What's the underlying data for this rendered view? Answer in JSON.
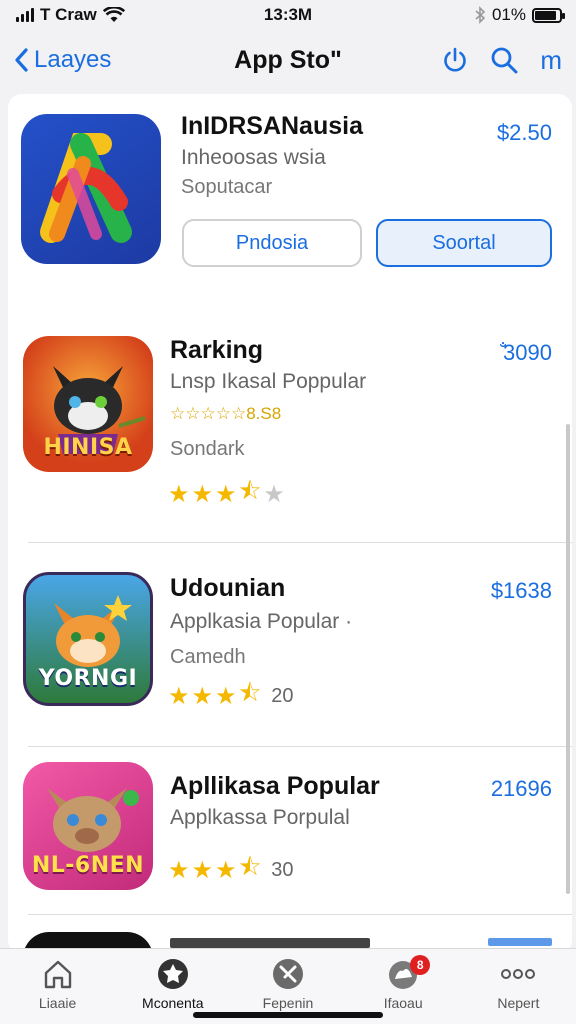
{
  "status_bar": {
    "carrier": "T Craw",
    "time": "13:3M",
    "battery": "01%"
  },
  "nav": {
    "back_label": "Laayes",
    "title": "App Stoʺ",
    "action_m": "m"
  },
  "featured": {
    "name": "InIDRSANausia",
    "subtitle": "Inheoosas wsia",
    "category": "Soputacar",
    "price": "$2.50",
    "button_left": "Pndosia",
    "button_right": "Soortal"
  },
  "apps": [
    {
      "name": "Rarking",
      "subtitle": "Lnsp Ikasal Poppular",
      "mini_rating": "☆☆☆☆☆8.S8",
      "category": "Sondark",
      "price": "̐3090",
      "rating_count": "",
      "icon_text": "HINISA",
      "stars": 3.5
    },
    {
      "name": "Udounian",
      "subtitle": "Applkasia Popular ·",
      "category": "Camedh",
      "price": "$1638",
      "rating_count": "20",
      "icon_text": "YORNGI",
      "stars": 3.5
    },
    {
      "name": "Apllikasa Popular",
      "subtitle": "Applkassa Porpulal",
      "category": "",
      "price": "21696",
      "rating_count": "30",
      "icon_text": "NL-6NEN",
      "stars": 3.5
    }
  ],
  "tabs": [
    {
      "label": "Liaaie",
      "icon": "home-icon"
    },
    {
      "label": "Mconenta",
      "icon": "flower-icon"
    },
    {
      "label": "Fepenin",
      "icon": "arcade-icon"
    },
    {
      "label": "Ifaoau",
      "icon": "updates-icon",
      "badge": "8"
    },
    {
      "label": "Nepert",
      "icon": "more-icon"
    }
  ],
  "colors": {
    "accent": "#1a6ee0",
    "star": "#f5b800",
    "badge": "#e02020"
  }
}
